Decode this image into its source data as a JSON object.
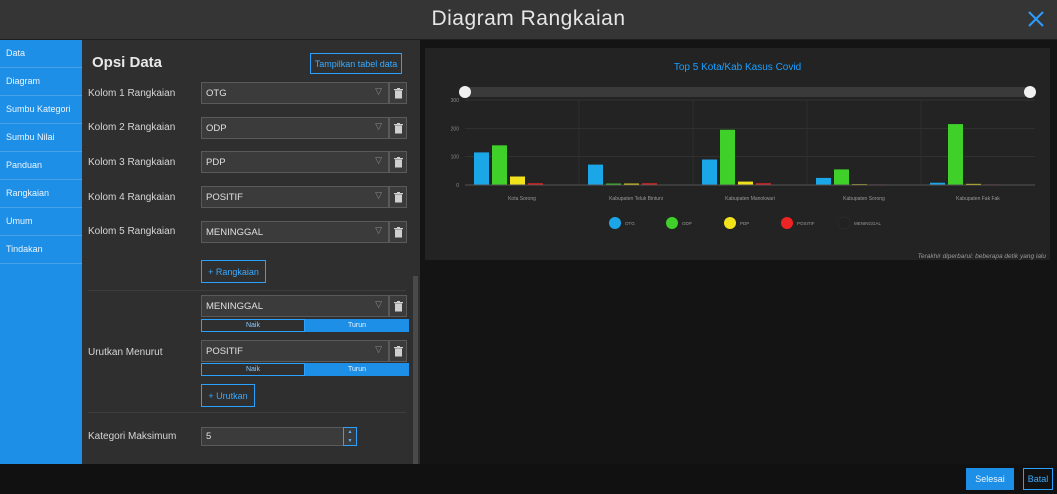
{
  "window": {
    "title": "Diagram Rangkaian"
  },
  "nav": {
    "items": [
      {
        "label": "Data",
        "active": true
      },
      {
        "label": "Diagram",
        "active": false
      },
      {
        "label": "Sumbu Kategori",
        "active": false
      },
      {
        "label": "Sumbu Nilai",
        "active": false
      },
      {
        "label": "Panduan",
        "active": false
      },
      {
        "label": "Rangkaian",
        "active": false
      },
      {
        "label": "Umum",
        "active": false
      },
      {
        "label": "Tindakan",
        "active": false
      }
    ]
  },
  "options": {
    "title": "Opsi Data",
    "show_table_label": "Tampilkan tabel data",
    "series_rows": [
      {
        "label": "Kolom 1 Rangkaian",
        "value": "OTG"
      },
      {
        "label": "Kolom 2 Rangkaian",
        "value": "ODP"
      },
      {
        "label": "Kolom 3 Rangkaian",
        "value": "PDP"
      },
      {
        "label": "Kolom 4 Rangkaian",
        "value": "POSITIF"
      },
      {
        "label": "Kolom 5 Rangkaian",
        "value": "MENINGGAL"
      }
    ],
    "add_series_label": "+ Rangkaian",
    "sort_label": "Urutkan Menurut",
    "sort_rows": [
      {
        "value": "MENINGGAL",
        "asc_label": "Naik",
        "desc_label": "Turun",
        "selected": "Turun"
      },
      {
        "value": "POSITIF",
        "asc_label": "Naik",
        "desc_label": "Turun",
        "selected": "Turun"
      }
    ],
    "add_sort_label": "+ Urutkan",
    "max_category_label": "Kategori Maksimum",
    "max_category_value": "5"
  },
  "chart_data": {
    "type": "bar",
    "title": "Top 5 Kota/Kab Kasus Covid",
    "categories": [
      "Kota Sorong",
      "Kabupaten Teluk Bintuni",
      "Kabupaten Manokwari",
      "Kabupaten Sorong",
      "Kabupaten Fak Fak"
    ],
    "series": [
      {
        "name": "OTG",
        "color": "#1ba6e8",
        "values": [
          115,
          72,
          90,
          25,
          8
        ]
      },
      {
        "name": "ODP",
        "color": "#3fd12a",
        "values": [
          140,
          5,
          195,
          55,
          215
        ]
      },
      {
        "name": "PDP",
        "color": "#f2e21c",
        "values": [
          30,
          5,
          12,
          3,
          4
        ]
      },
      {
        "name": "POSITIF",
        "color": "#ee2424",
        "values": [
          6,
          6,
          6,
          2,
          2
        ]
      },
      {
        "name": "MENINGGAL",
        "color": "#222222",
        "values": [
          0,
          0,
          0,
          0,
          0
        ]
      }
    ],
    "y_ticks": [
      "0",
      "100",
      "200",
      "300"
    ],
    "ylim": [
      0,
      300
    ],
    "legend_position": "bottom",
    "grid": true,
    "zoom_slider": true
  },
  "footer": {
    "updated_text": "Terakhir diperbarui: beberapa detik yang lalu",
    "done_label": "Selesai",
    "cancel_label": "Batal"
  }
}
